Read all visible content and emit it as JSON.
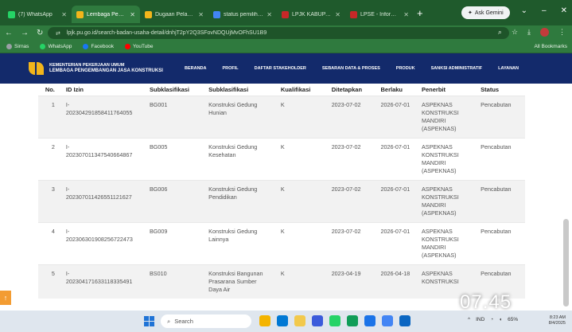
{
  "browser": {
    "tabs": [
      {
        "label": "(7) WhatsApp",
        "color": "#25d366",
        "active": false
      },
      {
        "label": "Lembaga Pengem",
        "color": "#f2b51b",
        "active": true
      },
      {
        "label": "Dugaan Pelangg",
        "color": "#f2b51b",
        "active": false
      },
      {
        "label": "status pemilihan",
        "color": "#4285f4",
        "active": false
      },
      {
        "label": "LPJK KABUPATEN",
        "color": "#c62828",
        "active": false
      },
      {
        "label": "LPSE - Informasi",
        "color": "#c62828",
        "active": false
      }
    ],
    "new_tab": "+",
    "gemini_label": "Ask Gemini",
    "url": "lpjk.pu.go.id/search-badan-usaha-detail/dnhjT2pY2Q3SFovNDQUjMvOFhSU1B9",
    "bookmarks": [
      {
        "label": "Sirnas",
        "color": "#9aa0a6"
      },
      {
        "label": "WhatsApp",
        "color": "#25d366"
      },
      {
        "label": "Facebook",
        "color": "#1877f2"
      },
      {
        "label": "YouTube",
        "color": "#ff0000"
      }
    ],
    "all_bookmarks": "All Bookmarks"
  },
  "site": {
    "ministry_line1": "KEMENTERIAN PEKERJAAN UMUM",
    "ministry_line2": "LEMBAGA PENGEMBANGAN JASA KONSTRUKSI",
    "nav": [
      "BERANDA",
      "PROFIL",
      "DAFTAR STAKEHOLDER",
      "SEBARAN DATA & PROSES",
      "PRODUK",
      "SANKSI ADMINISTRATIF",
      "LAYANAN"
    ]
  },
  "table": {
    "headers": {
      "no": "No.",
      "id": "ID Izin",
      "sub": "Subklasifikasi",
      "subname": "Subklasifikasi",
      "kual": "Kualifikasi",
      "dit": "Ditetapkan",
      "ber": "Berlaku",
      "pen": "Penerbit",
      "st": "Status"
    },
    "rows": [
      {
        "no": "1",
        "id": "I-\n202304291858411764055",
        "sub": "BG001",
        "subname": "Konstruksi Gedung\nHunian",
        "kual": "K",
        "dit": "2023-07-02",
        "ber": "2026-07-01",
        "pen": "ASPEKNAS\nKONSTRUKSI\nMANDIRI\n(ASPEKNAS)",
        "st": "Pencabutan"
      },
      {
        "no": "2",
        "id": "I-\n202307011347540664867",
        "sub": "BG005",
        "subname": "Konstruksi Gedung\nKesehatan",
        "kual": "K",
        "dit": "2023-07-02",
        "ber": "2026-07-01",
        "pen": "ASPEKNAS\nKONSTRUKSI\nMANDIRI\n(ASPEKNAS)",
        "st": "Pencabutan"
      },
      {
        "no": "3",
        "id": "I-\n202307011426551121627",
        "sub": "BG006",
        "subname": "Konstruksi Gedung\nPendidikan",
        "kual": "K",
        "dit": "2023-07-02",
        "ber": "2026-07-01",
        "pen": "ASPEKNAS\nKONSTRUKSI\nMANDIRI\n(ASPEKNAS)",
        "st": "Pencabutan"
      },
      {
        "no": "4",
        "id": "I-\n202306301908256722473",
        "sub": "BG009",
        "subname": "Konstruksi Gedung\nLainnya",
        "kual": "K",
        "dit": "2023-07-02",
        "ber": "2026-07-01",
        "pen": "ASPEKNAS\nKONSTRUKSI\nMANDIRI\n(ASPEKNAS)",
        "st": "Pencabutan"
      },
      {
        "no": "5",
        "id": "I-\n202304171633118335491",
        "sub": "BS010",
        "subname": "Konstruksi Bangunan\nPrasarana Sumber\nDaya Air",
        "kual": "K",
        "dit": "2023-04-19",
        "ber": "2026-04-18",
        "pen": "ASPEKNAS\nKONSTRUKSI",
        "st": "Pencabutan"
      }
    ]
  },
  "overlay_time": "07.45",
  "taskbar": {
    "search_placeholder": "Search",
    "apps": [
      "#f4b400",
      "#0078d4",
      "#f2c94c",
      "#3b5bdb",
      "#25d366",
      "#0f9d58",
      "#1a73e8",
      "#4285f4",
      "#0a66c2"
    ],
    "lang": "IND",
    "battery": "65%",
    "time": "8:23 AM",
    "date": "8/4/2025"
  }
}
